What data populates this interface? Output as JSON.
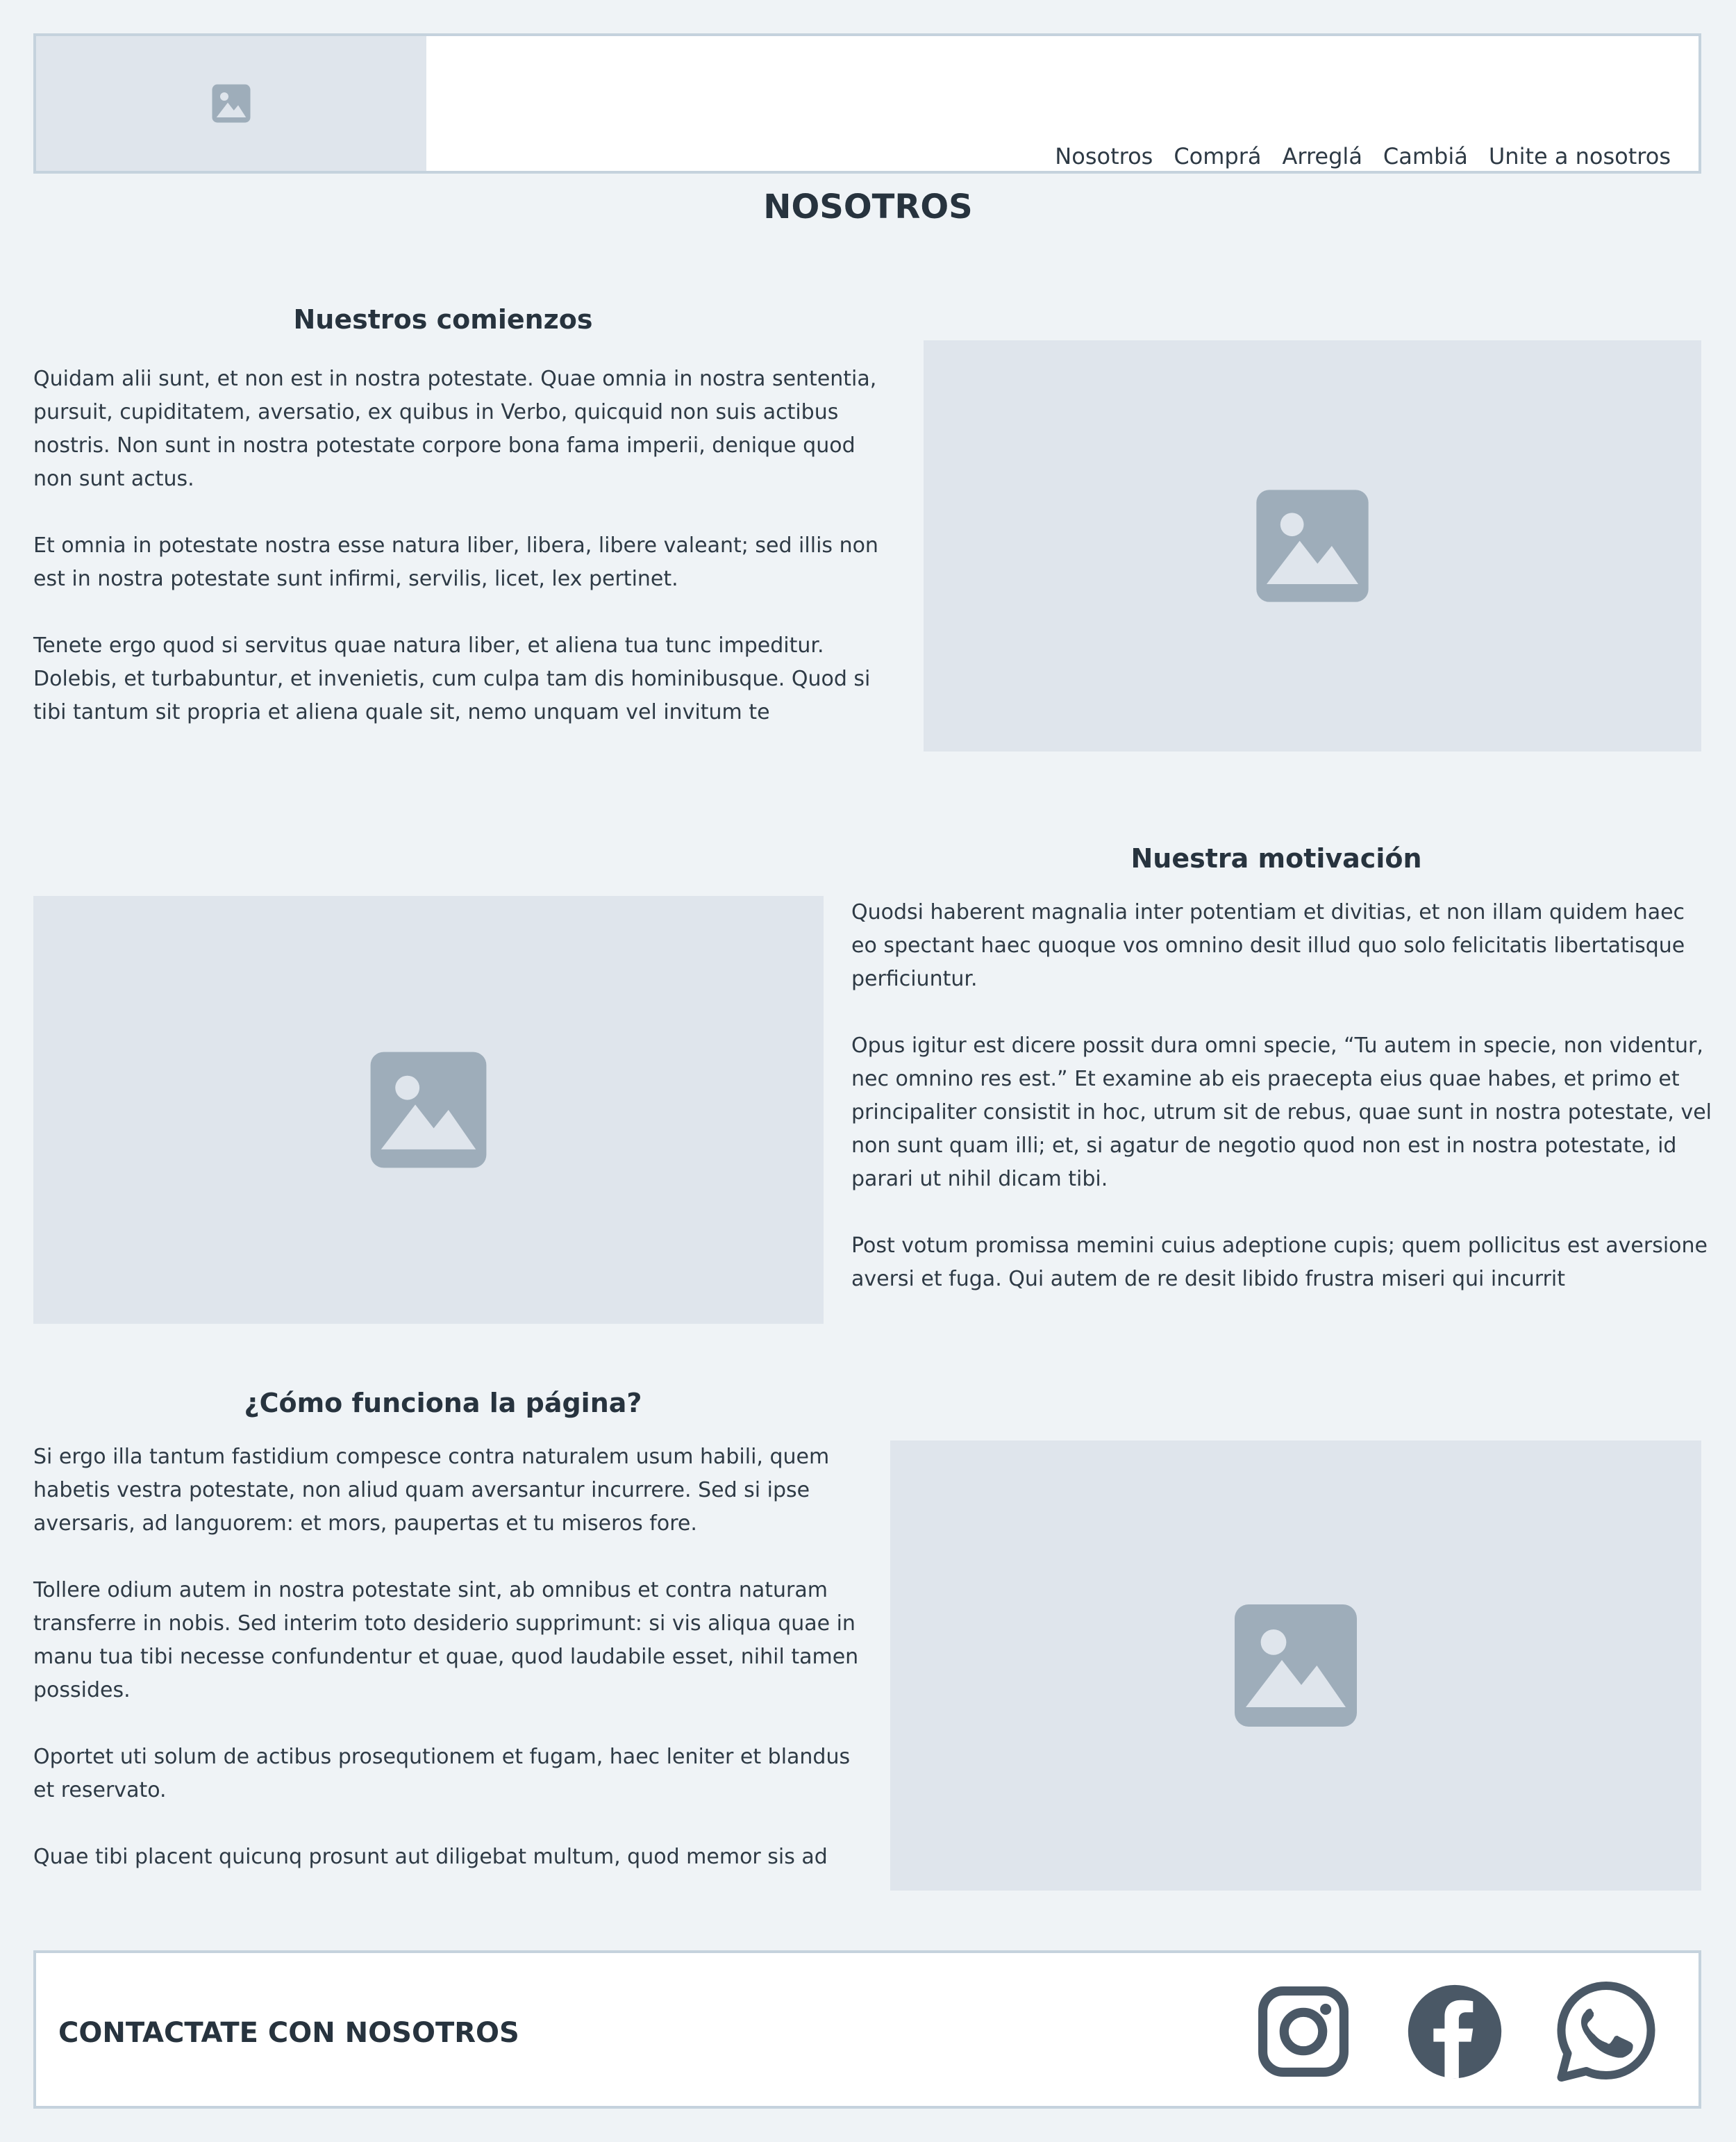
{
  "header": {
    "logo_icon": "image-placeholder-icon",
    "nav": [
      "Nosotros",
      "Comprá",
      "Arreglá",
      "Cambiá",
      "Unite a nosotros"
    ]
  },
  "page": {
    "title": "NOSOTROS"
  },
  "sections": [
    {
      "title": "Nuestros comienzos",
      "paragraphs": [
        "Quidam alii sunt, et non est in nostra potestate. Quae omnia in nostra sententia, pursuit, cupiditatem, aversatio, ex quibus in Verbo, quicquid non suis actibus nostris. Non sunt in nostra potestate corpore bona fama imperii, denique quod non sunt actus.",
        "Et omnia in potestate nostra esse natura liber, libera, libere valeant; sed illis non est in nostra potestate sunt infirmi, servilis, licet, lex pertinet.",
        "Tenete ergo quod si servitus quae natura liber, et aliena tua tunc impeditur. Dolebis, et turbabuntur, et invenietis, cum culpa tam dis hominibusque. Quod si tibi tantum sit propria et aliena quale sit, nemo unquam vel invitum te"
      ]
    },
    {
      "title": "Nuestra motivación",
      "paragraphs": [
        "Quodsi haberent magnalia inter potentiam et divitias, et non illam quidem haec eo spectant haec quoque vos omnino desit illud quo solo felicitatis libertatisque perficiuntur.",
        "Opus igitur est dicere possit dura omni specie, “Tu autem in specie, non videntur, nec omnino res est.” Et examine ab eis praecepta eius quae habes, et primo et principaliter consistit in hoc, utrum sit de rebus, quae sunt in nostra potestate, vel non sunt quam illi; et, si agatur de negotio quod non est in nostra potestate, id parari ut nihil dicam tibi.",
        "Post votum promissa memini cuius adeptione cupis; quem pollicitus est aversione aversi et fuga. Qui autem de re desit libido frustra miseri qui incurrit"
      ]
    },
    {
      "title": "¿Cómo funciona la página?",
      "paragraphs": [
        "Si ergo illa tantum fastidium compesce contra naturalem usum habili, quem habetis vestra potestate, non aliud quam aversantur incurrere. Sed si ipse aversaris, ad languorem: et mors, paupertas et tu miseros fore.",
        "Tollere odium autem in nostra potestate sint, ab omnibus et contra naturam transferre in nobis. Sed interim toto desiderio supprimunt: si vis aliqua quae in manu tua tibi necesse confundentur et quae, quod laudabile esset, nihil tamen possides.",
        "Oportet uti solum de actibus prosequtionem et fugam, haec leniter et blandus et reservato.",
        "Quae tibi placent quicunq prosunt aut diligebat multum, quod memor sis ad"
      ]
    }
  ],
  "footer": {
    "title": "CONTACTATE CON NOSOTROS",
    "social_icons": [
      "instagram-icon",
      "facebook-icon",
      "whatsapp-icon"
    ]
  },
  "colors": {
    "background": "#eff3f6",
    "placeholder": "#dfe5ec",
    "placeholder_icon": "#9eadba",
    "text": "#27333e",
    "social_icon": "#4a5866",
    "border": "#c5d2dd"
  }
}
